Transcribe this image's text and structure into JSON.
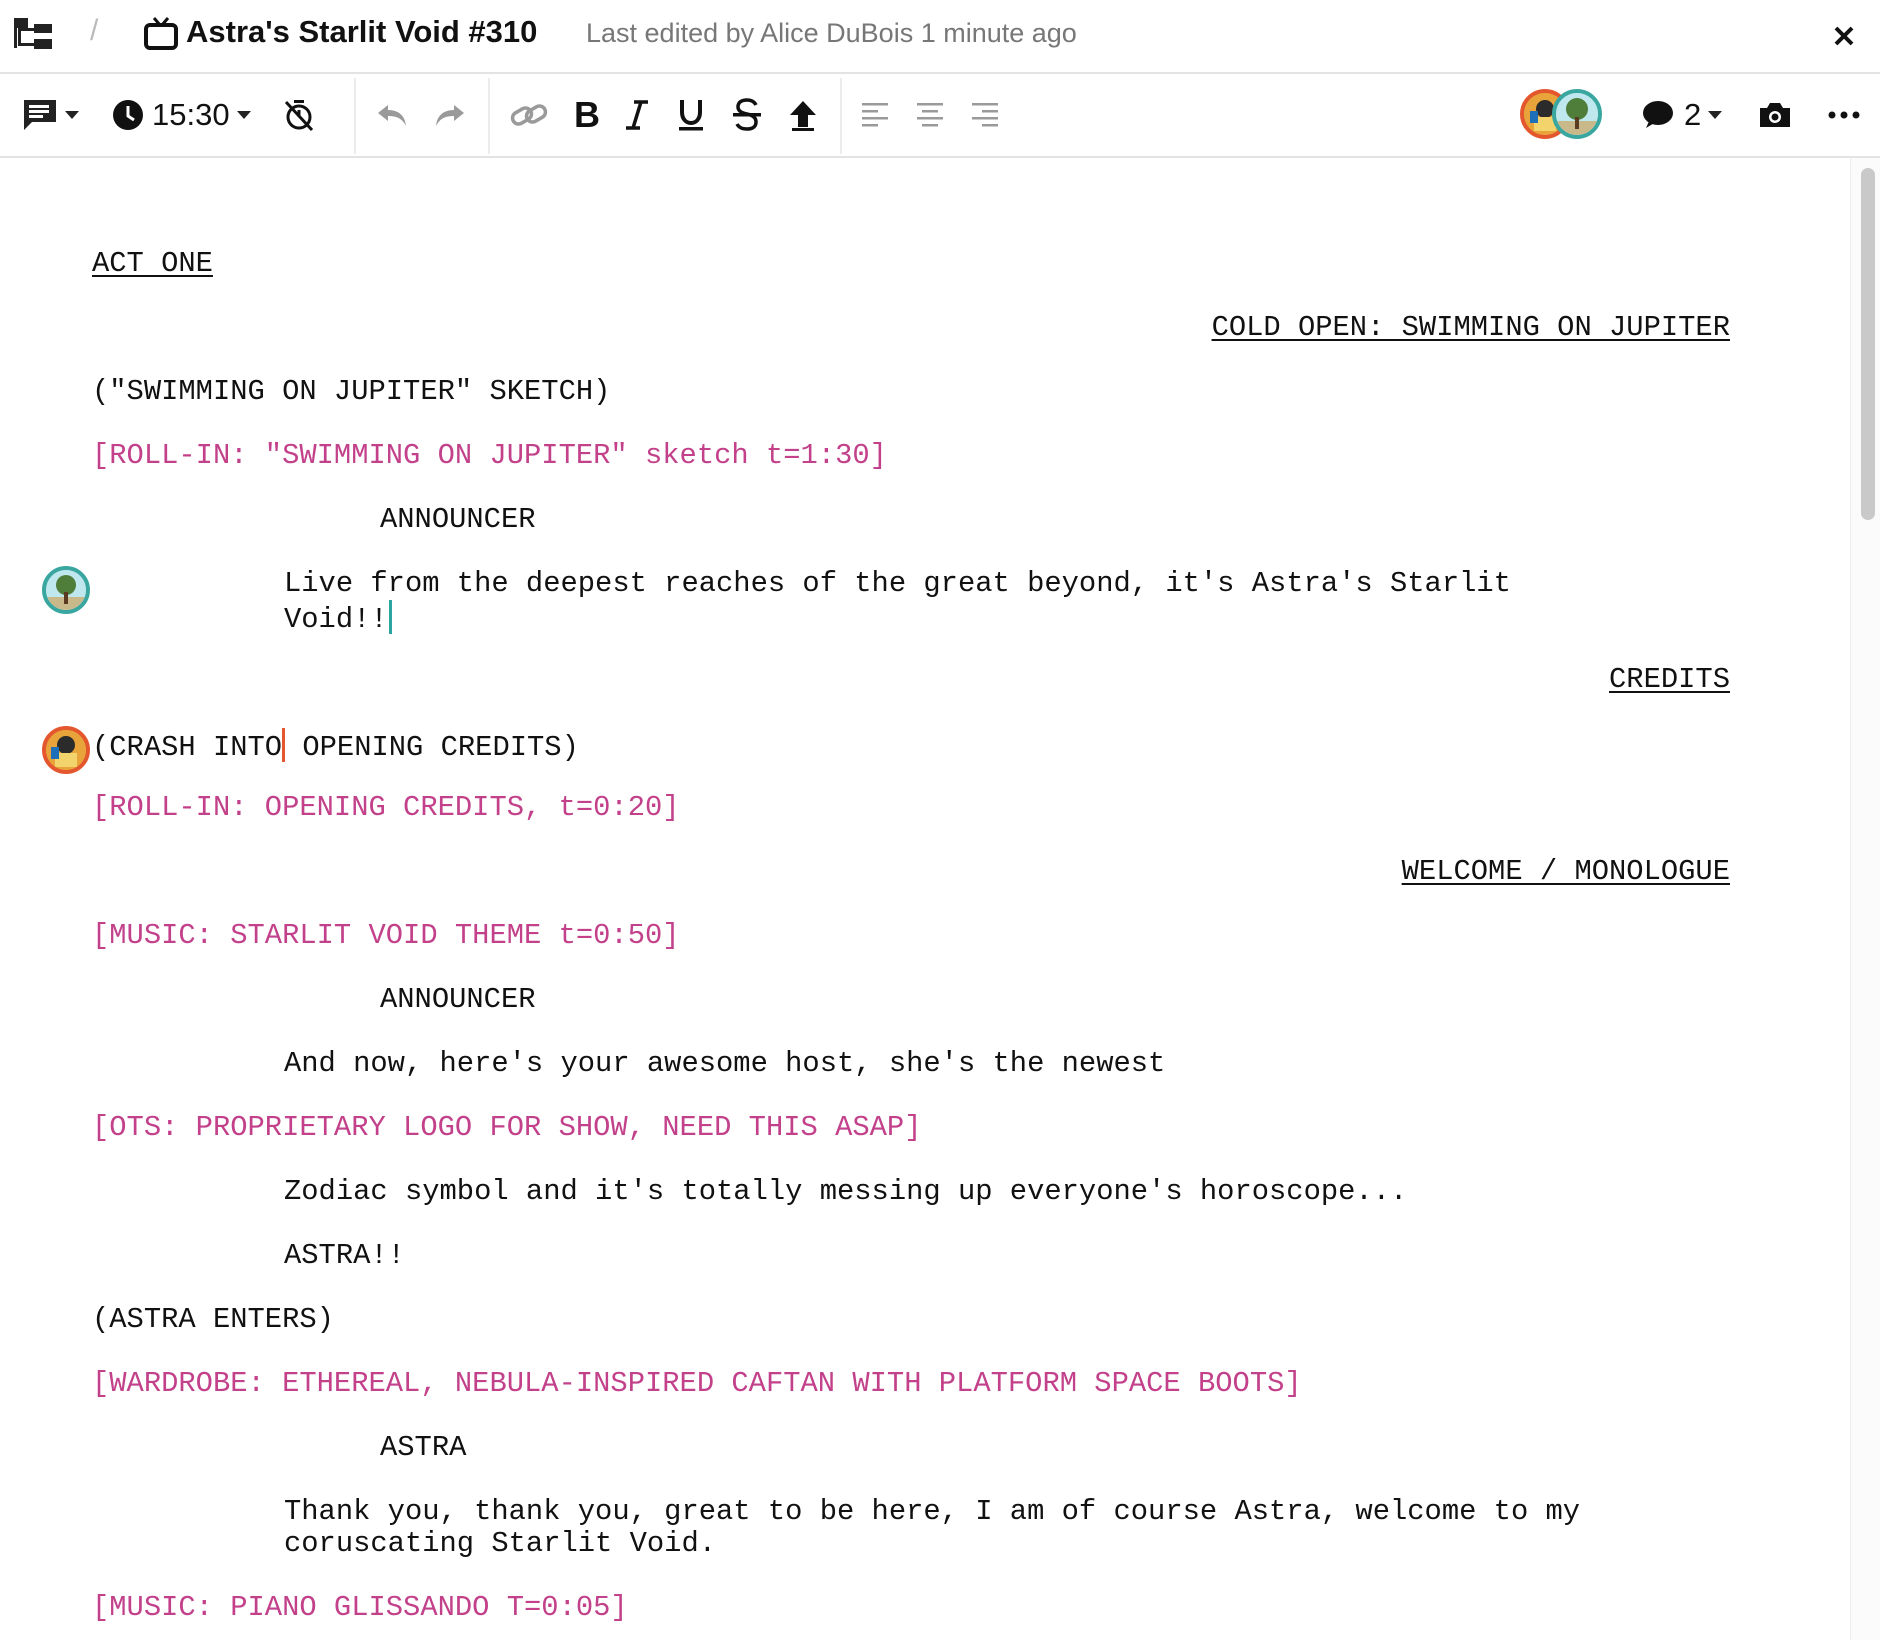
{
  "title_bar": {
    "document_title": "Astra's Starlit Void #310",
    "separator": "/",
    "last_edited": "Last edited by Alice DuBois 1 minute ago",
    "icons": {
      "menu": "sidebar-tree-icon",
      "doc": "tv-icon",
      "close": "close-icon"
    }
  },
  "toolbar": {
    "comment_icon": "comment-menu-icon",
    "time": "15:30",
    "timer_icon": "timer-off-icon",
    "undo_icon": "undo-icon",
    "redo_icon": "redo-icon",
    "link_icon": "link-icon",
    "bold_icon": "bold-icon",
    "italic_icon": "italic-icon",
    "underline_icon": "underline-icon",
    "strike_icon": "strikethrough-icon",
    "upload_icon": "upload-arrow-icon",
    "align_icons": [
      "align-left-icon",
      "align-center-icon",
      "align-right-icon"
    ],
    "comment_count": "2",
    "camera_icon": "camera-icon",
    "more_icon": "more-icon"
  },
  "colors": {
    "cue": "#c2418a",
    "caret_teal": "#2aa5a2",
    "caret_orange": "#e4572e"
  },
  "script": {
    "act": "ACT ONE",
    "cold_open": "COLD OPEN: SWIMMING ON JUPITER",
    "sketch": "(\"SWIMMING ON JUPITER\" SKETCH)",
    "rollin1": "[ROLL-IN: \"SWIMMING ON JUPITER\" sketch t=1:30]",
    "char1": "ANNOUNCER",
    "dial1_l1": "Live from the deepest reaches of the great beyond, it's Astra's Starlit",
    "dial1_l2": "Void!!",
    "credits": "CREDITS",
    "crash_a": "(CRASH INTO",
    "crash_b": " OPENING CREDITS)",
    "rollin2": "[ROLL-IN: OPENING CREDITS, t=0:20]",
    "welcome": "WELCOME / MONOLOGUE",
    "music1": "[MUSIC: STARLIT VOID THEME t=0:50]",
    "char2": "ANNOUNCER",
    "dial2": "And now, here's your awesome host, she's the newest",
    "ots": "[OTS: PROPRIETARY LOGO FOR SHOW, NEED THIS ASAP]",
    "dial3": "Zodiac symbol and it's totally messing up everyone's horoscope...",
    "dial4": "ASTRA!!",
    "astra_enters": "(ASTRA ENTERS)",
    "wardrobe": "[WARDROBE: ETHEREAL, NEBULA-INSPIRED CAFTAN WITH PLATFORM SPACE BOOTS]",
    "char3": "ASTRA",
    "dial5_l1": "Thank you, thank you, great to be here, I am of course Astra, welcome to my",
    "dial5_l2": "coruscating Starlit Void.",
    "music2": "[MUSIC: PIANO GLISSANDO T=0:05]"
  }
}
